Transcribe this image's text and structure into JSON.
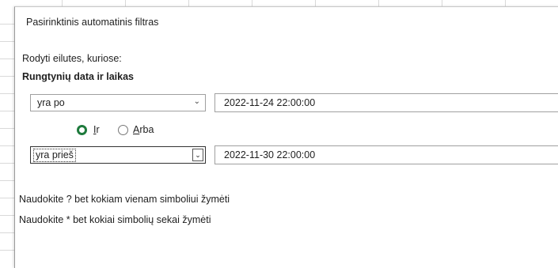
{
  "dialog": {
    "title": "Pasirinktinis automatinis filtras",
    "caption": "Rodyti eilutes, kuriose:",
    "field_name": "Rungtynių data ir laikas"
  },
  "criteria": [
    {
      "operator": "yra po",
      "value": "2022-11-24  22:00:00"
    },
    {
      "operator": "yra prieš",
      "value": "2022-11-30  22:00:00"
    }
  ],
  "logic": {
    "and_label_prefix": "",
    "and_access_key": "I",
    "and_label_rest": "r",
    "or_access_key": "A",
    "or_label_rest": "rba",
    "selected": "and"
  },
  "hints": [
    "Naudokite ? bet kokiam vienam simboliui žymėti",
    "Naudokite * bet kokiai simbolių sekai žymėti"
  ],
  "icons": {
    "dropdown": "chevron-down-icon",
    "radio_on": "radio-selected-icon",
    "radio_off": "radio-unselected-icon"
  },
  "colors": {
    "radio_selected": "#1e7a3c",
    "border": "#a0a0a0"
  }
}
